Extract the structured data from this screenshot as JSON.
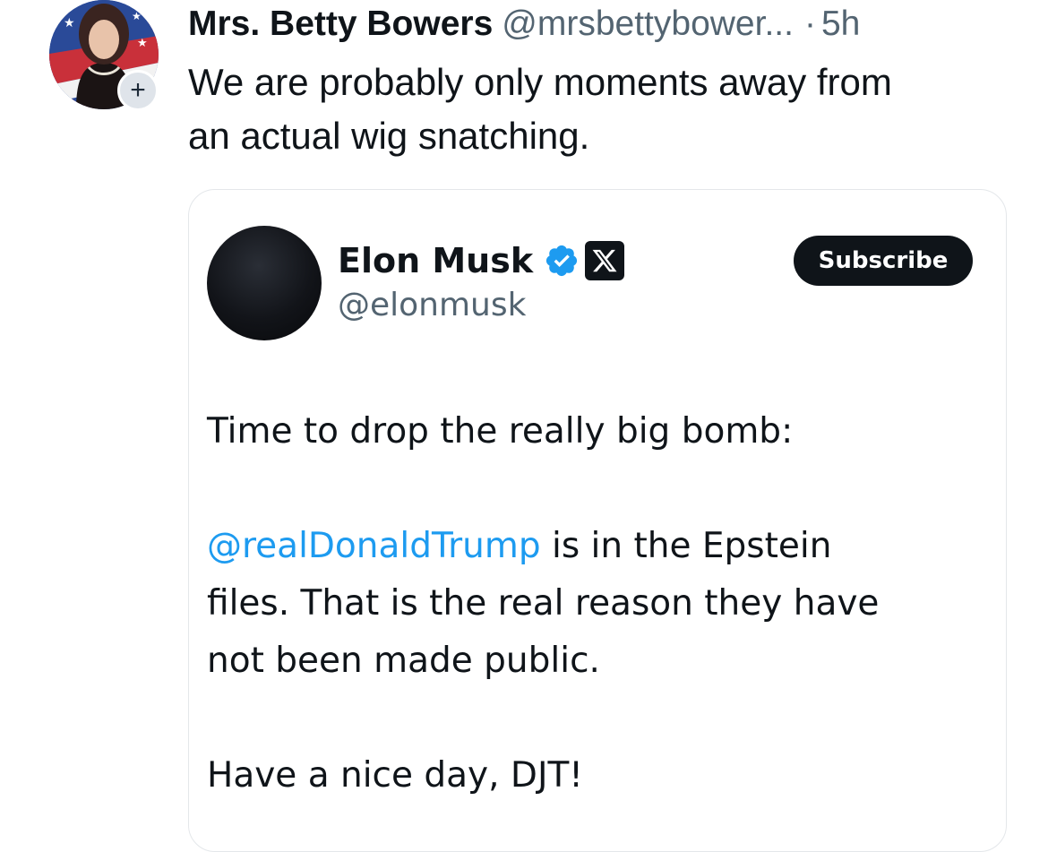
{
  "post": {
    "author_name": "Mrs. Betty Bowers",
    "author_handle": "@mrsbettybower...",
    "separator": "·",
    "time": "5h",
    "follow_symbol": "+",
    "text_lines": [
      "We are probably only moments away from",
      "an actual wig snatching."
    ]
  },
  "quoted": {
    "author_name": "Elon Musk",
    "author_handle": "@elonmusk",
    "subscribe_label": "Subscribe",
    "paragraph1": "Time to drop the really big bomb:",
    "mention": "@realDonaldTrump",
    "paragraph2_rest_line1": " is in the Epstein",
    "paragraph2_line2": "files. That is the real reason they have",
    "paragraph2_line3": "not been made public.",
    "paragraph3": "Have a nice day, DJT!",
    "icons": [
      "verified-badge-icon",
      "x-logo-icon"
    ],
    "colors": {
      "mention": "#1d9bf0",
      "verified": "#1d9bf0",
      "button_bg": "#0f1419"
    }
  }
}
